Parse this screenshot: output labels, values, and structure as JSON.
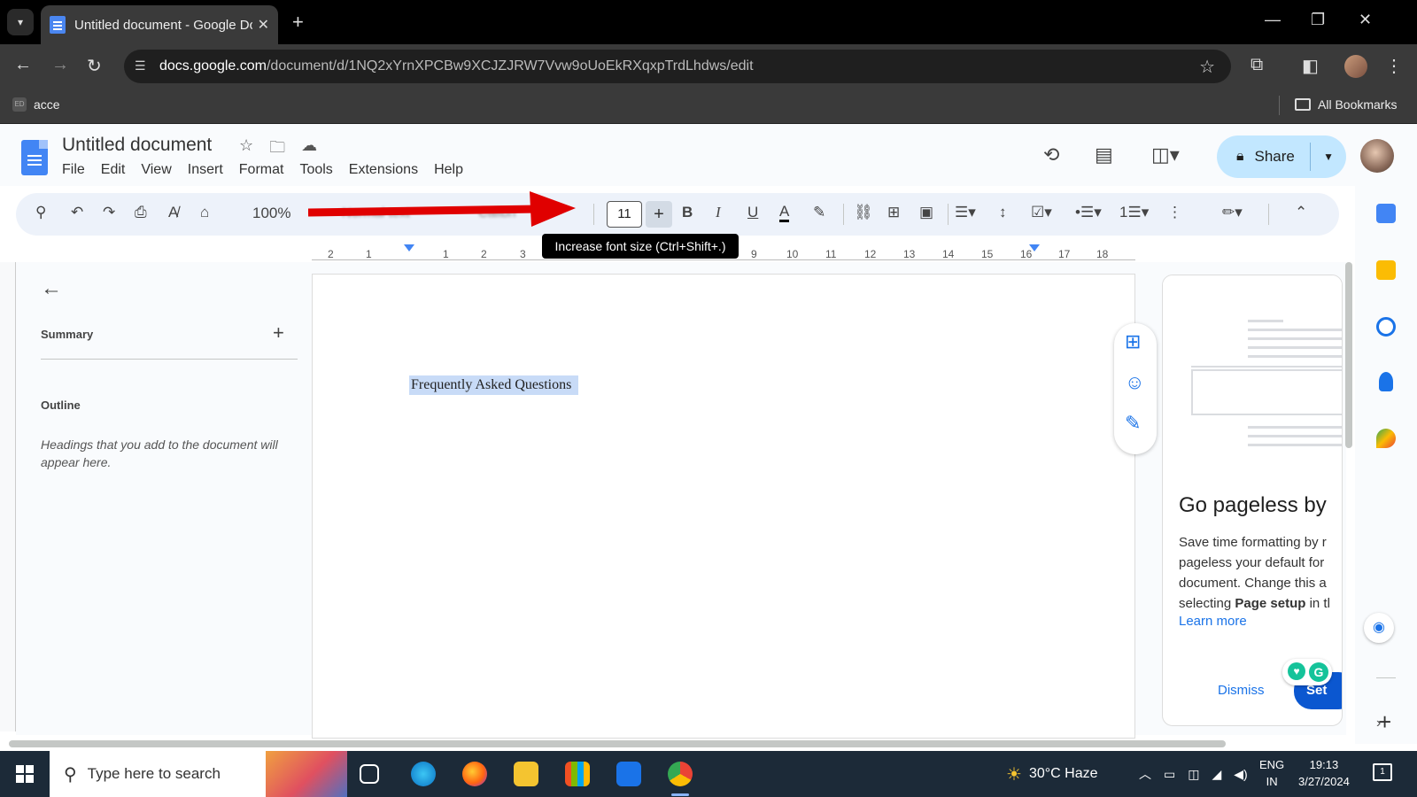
{
  "browser": {
    "tab_title": "Untitled document - Google Dc",
    "url_host": "docs.google.com",
    "url_path": "/document/d/1NQ2xYrnXPCBw9XCJZJRW7Vvw9oUoEkRXqxpTrdLhdws/edit",
    "bookmark_item": "acce",
    "all_bookmarks": "All Bookmarks"
  },
  "docs": {
    "title": "Untitled document",
    "menu": [
      "File",
      "Edit",
      "View",
      "Insert",
      "Format",
      "Tools",
      "Extensions",
      "Help"
    ],
    "share_label": "Share"
  },
  "toolbar": {
    "zoom": "100%",
    "style": "Normal text",
    "font": "Calibri",
    "font_size": "11",
    "tooltip": "Increase font size (Ctrl+Shift+.)"
  },
  "ruler": {
    "numbers": [
      "2",
      "1",
      "1",
      "2",
      "3",
      "9",
      "10",
      "11",
      "12",
      "13",
      "14",
      "15",
      "16",
      "17",
      "18"
    ]
  },
  "outline": {
    "summary_label": "Summary",
    "outline_label": "Outline",
    "hint": "Headings that you add to the document will appear here."
  },
  "document": {
    "text": "Frequently Asked Questions"
  },
  "promo": {
    "title": "Go pageless by",
    "body_line1": "Save time formatting by r",
    "body_line2": "pageless your default for",
    "body_line3": "document. Change this a",
    "body_line4_prefix": "selecting ",
    "body_line4_bold": "Page setup",
    "body_line4_suffix": " in tl",
    "learn_more": "Learn more",
    "dismiss": "Dismiss",
    "set": "Set"
  },
  "taskbar": {
    "search_placeholder": "Type here to search",
    "weather": "30°C  Haze",
    "lang_line1": "ENG",
    "lang_line2": "IN",
    "time": "19:13",
    "date": "3/27/2024",
    "notification_count": "1"
  },
  "colors": {
    "accent": "#1a73e8",
    "share_bg": "#c2e7ff",
    "toolbar_bg": "#edf2fa",
    "arrow": "#e00000",
    "selection": "#c8dbf7"
  }
}
